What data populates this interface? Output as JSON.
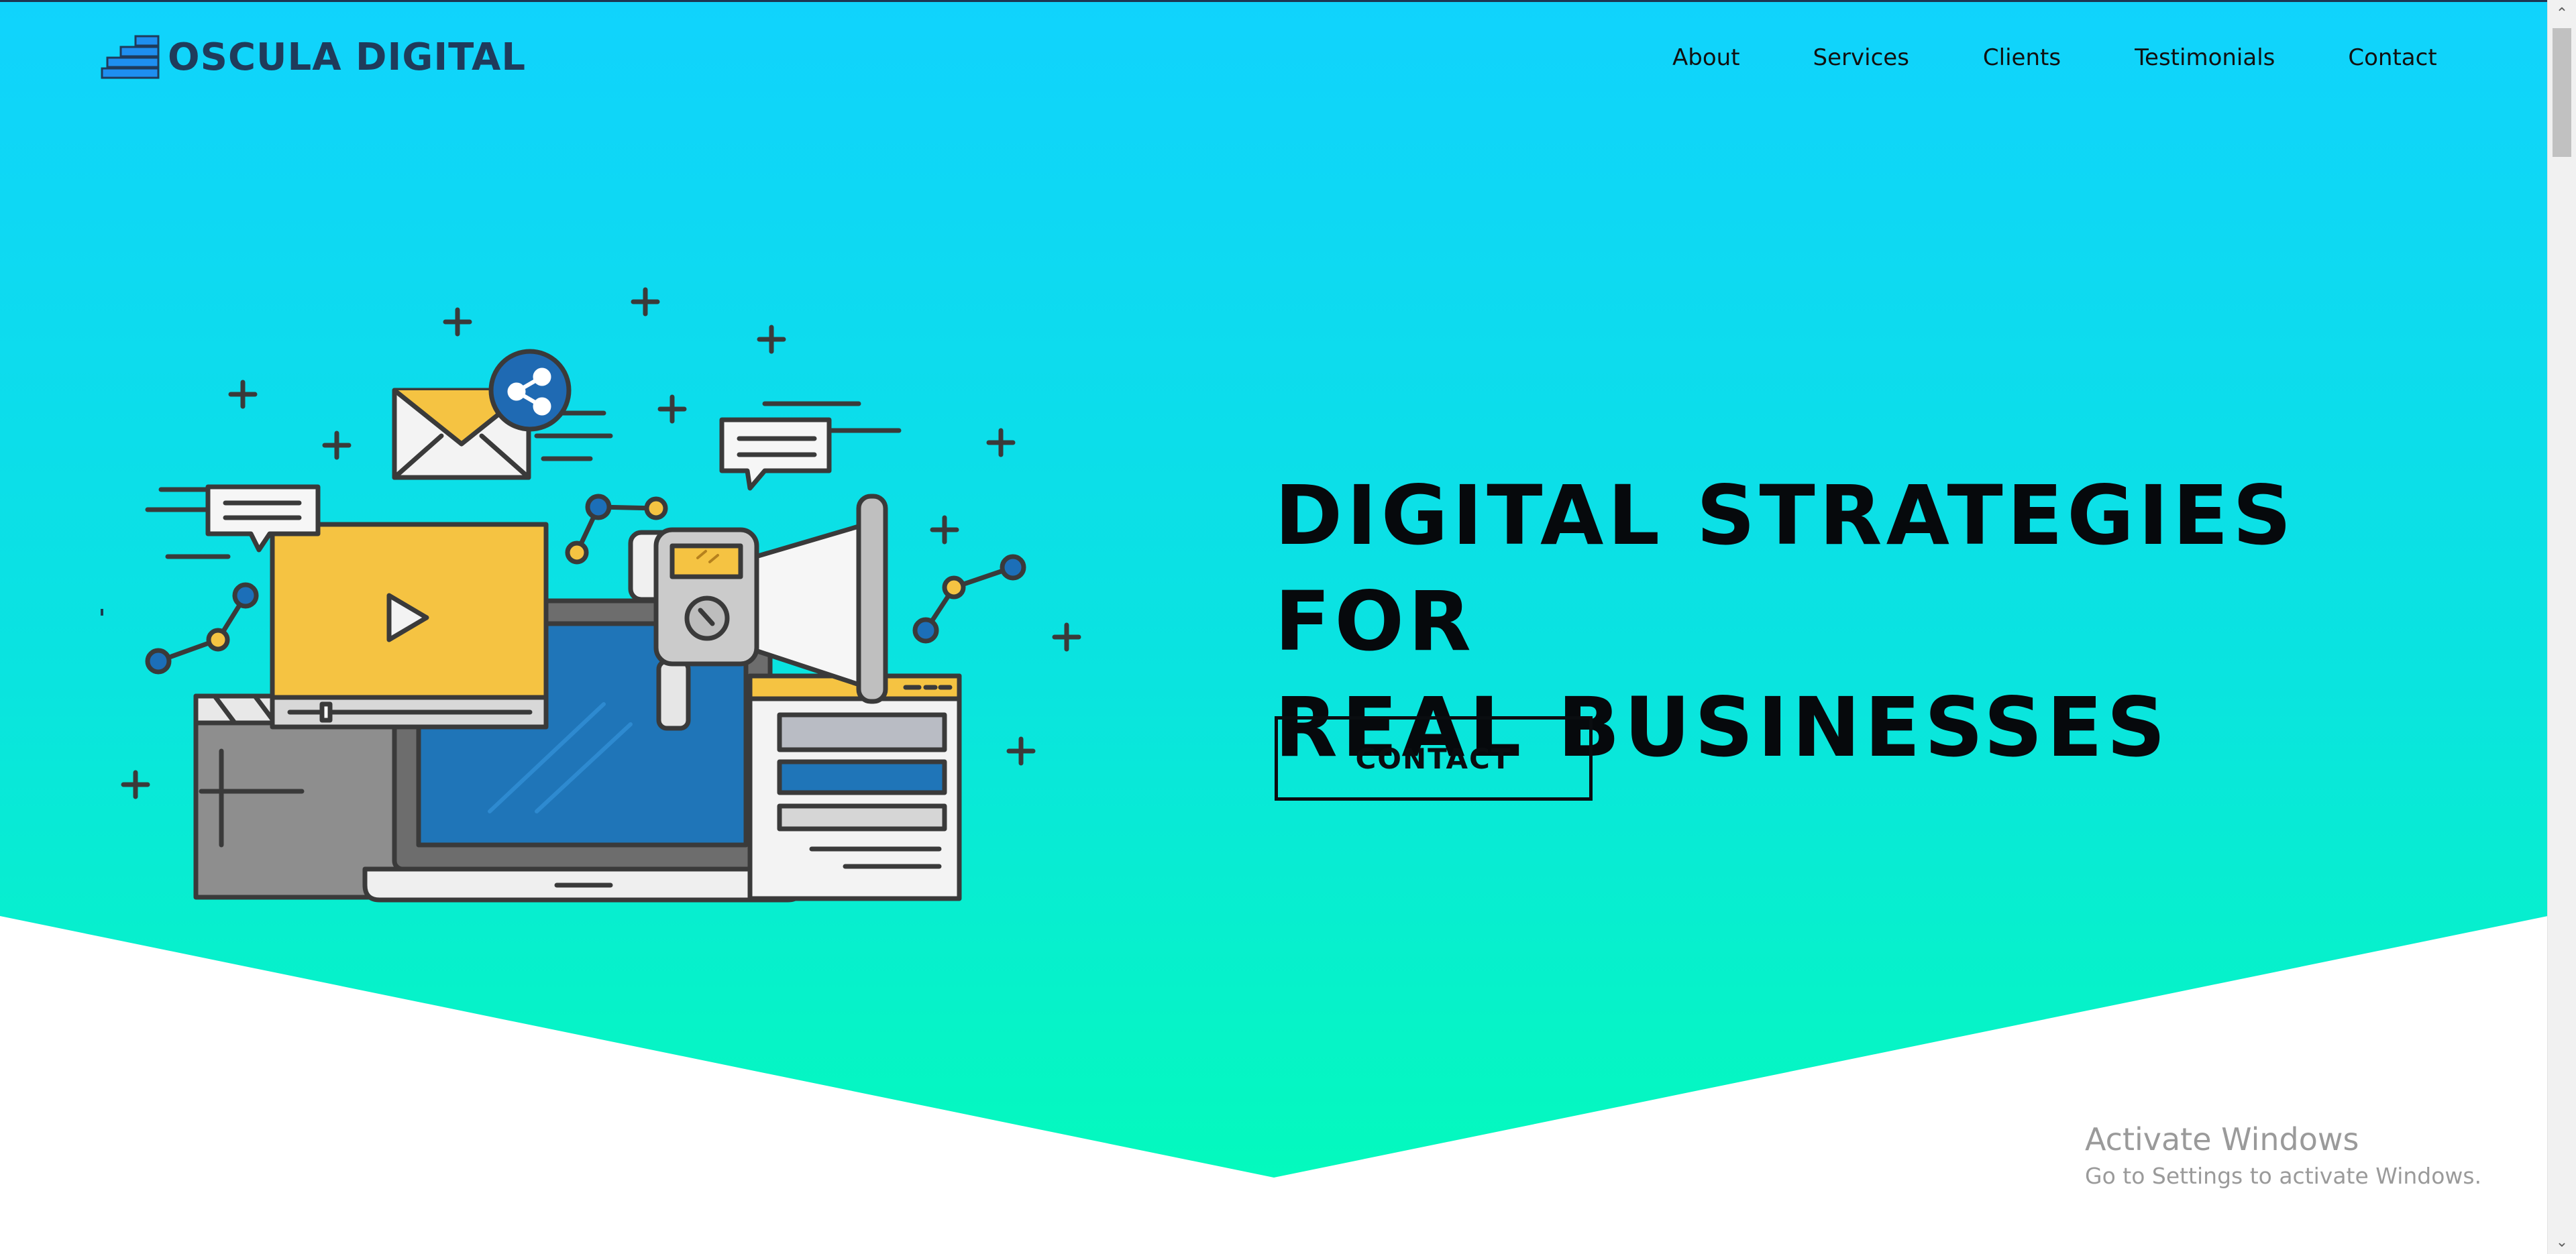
{
  "brand": {
    "name": "OSCULA DIGITAL",
    "logo_color": "#1f3b5b",
    "logo_accent": "#1e8ff0"
  },
  "nav": {
    "items": [
      {
        "label": "About"
      },
      {
        "label": "Services"
      },
      {
        "label": "Clients"
      },
      {
        "label": "Testimonials"
      },
      {
        "label": "Contact"
      }
    ]
  },
  "hero": {
    "headline_line1": "DIGITAL STRATEGIES FOR",
    "headline_line2": "REAL BUSINESSES",
    "cta_label": "CONTACT",
    "gradient_top": "#10d3fd",
    "gradient_bottom": "#04fabd"
  },
  "watermark": {
    "title": "Activate Windows",
    "subtitle": "Go to Settings to activate Windows."
  },
  "icons": {
    "illustration": "digital-marketing-illustration",
    "scroll_up": "chevron-up-icon",
    "scroll_down": "chevron-down-icon"
  }
}
